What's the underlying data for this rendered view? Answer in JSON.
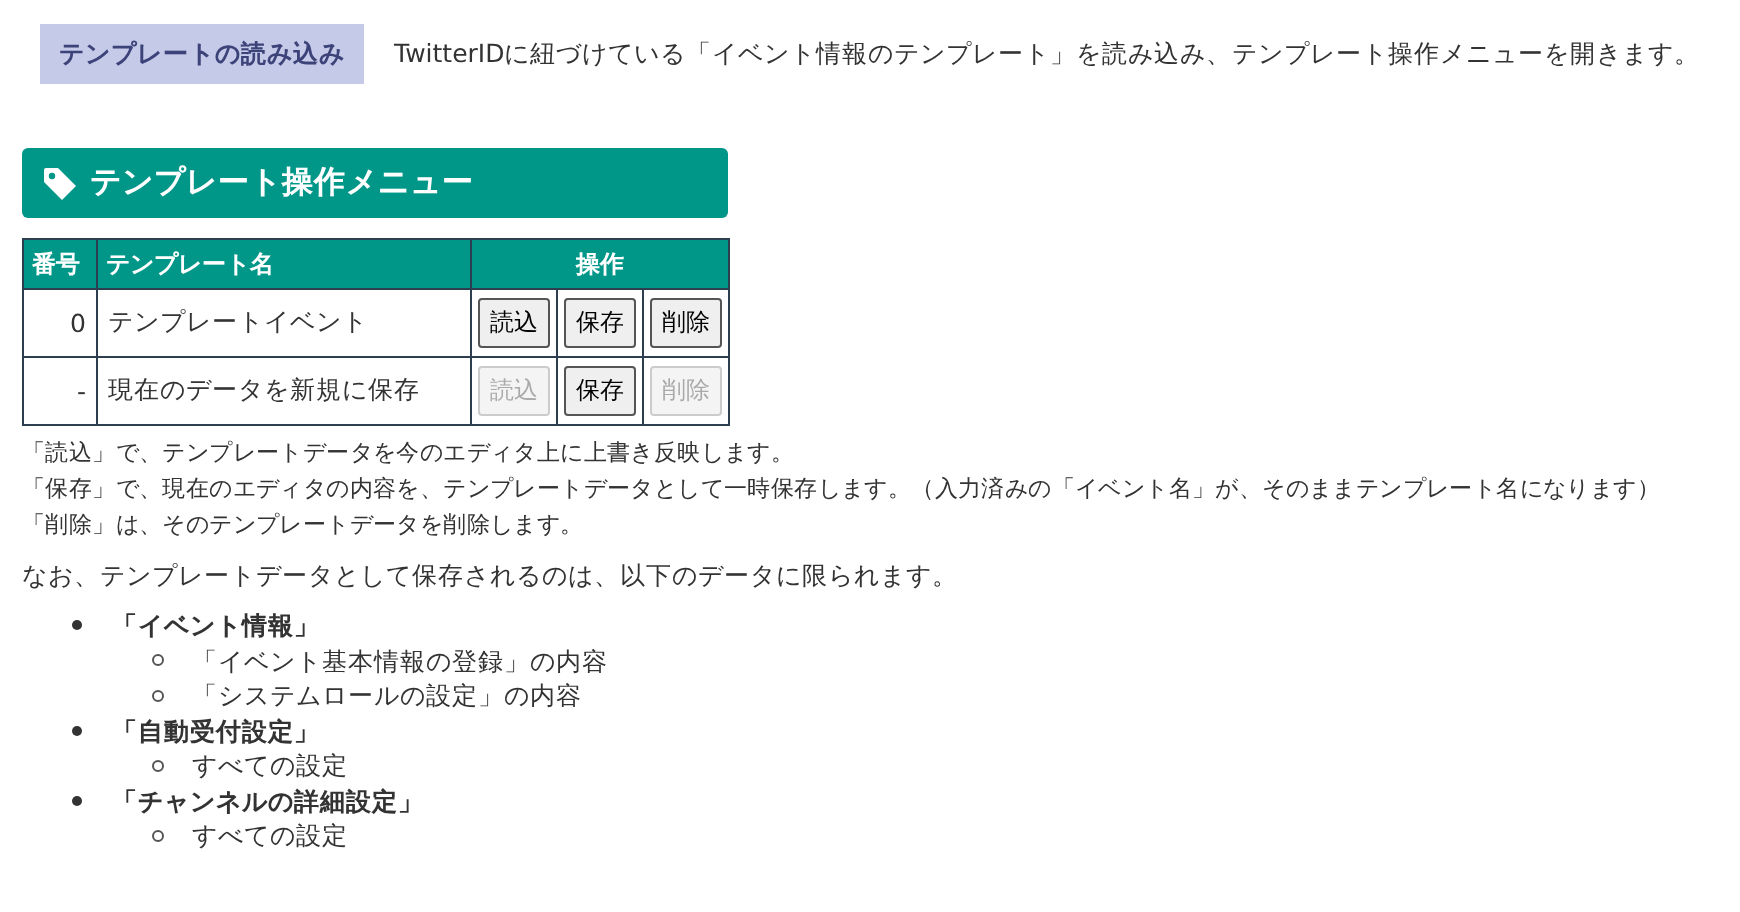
{
  "load_button": {
    "label": "テンプレートの読み込み",
    "disabled": true
  },
  "load_description": "TwitterIDに紐づけている「イベント情報のテンプレート」を読み込み、テンプレート操作メニューを開きます。",
  "menu_title": "テンプレート操作メニュー",
  "table": {
    "columns": [
      "番号",
      "テンプレート名",
      "操作"
    ],
    "rows": [
      {
        "number": "0",
        "name": "テンプレートイベント",
        "actions": [
          {
            "label": "読込",
            "disabled": false
          },
          {
            "label": "保存",
            "disabled": false
          },
          {
            "label": "削除",
            "disabled": false
          }
        ]
      },
      {
        "number": "-",
        "name": "現在のデータを新規に保存",
        "actions": [
          {
            "label": "読込",
            "disabled": true
          },
          {
            "label": "保存",
            "disabled": false
          },
          {
            "label": "削除",
            "disabled": true
          }
        ]
      }
    ]
  },
  "notes": [
    "「読込」で、テンプレートデータを今のエディタ上に上書き反映します。",
    "「保存」で、現在のエディタの内容を、テンプレートデータとして一時保存します。（入力済みの「イベント名」が、そのままテンプレート名になります）",
    "「削除」は、そのテンプレートデータを削除します。"
  ],
  "saved_intro": "なお、テンプレートデータとして保存されるのは、以下のデータに限られます。",
  "saved_items": [
    {
      "label": "「イベント情報」",
      "children": [
        {
          "label": "「イベント基本情報の登録」の内容"
        },
        {
          "label": "「システムロールの設定」の内容"
        }
      ]
    },
    {
      "label": "「自動受付設定」",
      "children": [
        {
          "label": "すべての設定"
        }
      ]
    },
    {
      "label": "「チャンネルの詳細設定」",
      "children": [
        {
          "label": "すべての設定"
        }
      ]
    }
  ]
}
